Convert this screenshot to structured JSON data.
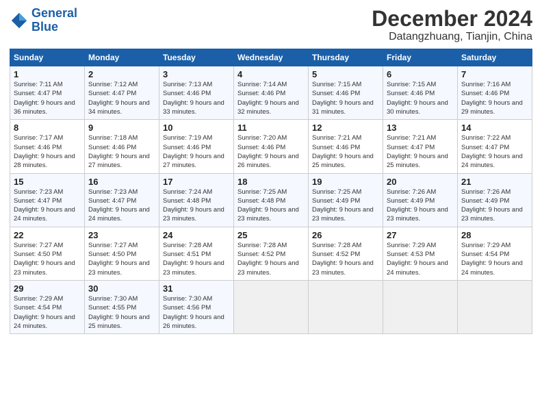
{
  "header": {
    "logo_line1": "General",
    "logo_line2": "Blue",
    "month": "December 2024",
    "location": "Datangzhuang, Tianjin, China"
  },
  "weekdays": [
    "Sunday",
    "Monday",
    "Tuesday",
    "Wednesday",
    "Thursday",
    "Friday",
    "Saturday"
  ],
  "weeks": [
    [
      {
        "day": "1",
        "sunrise": "7:11 AM",
        "sunset": "4:47 PM",
        "daylight": "9 hours and 36 minutes."
      },
      {
        "day": "2",
        "sunrise": "7:12 AM",
        "sunset": "4:47 PM",
        "daylight": "9 hours and 34 minutes."
      },
      {
        "day": "3",
        "sunrise": "7:13 AM",
        "sunset": "4:46 PM",
        "daylight": "9 hours and 33 minutes."
      },
      {
        "day": "4",
        "sunrise": "7:14 AM",
        "sunset": "4:46 PM",
        "daylight": "9 hours and 32 minutes."
      },
      {
        "day": "5",
        "sunrise": "7:15 AM",
        "sunset": "4:46 PM",
        "daylight": "9 hours and 31 minutes."
      },
      {
        "day": "6",
        "sunrise": "7:15 AM",
        "sunset": "4:46 PM",
        "daylight": "9 hours and 30 minutes."
      },
      {
        "day": "7",
        "sunrise": "7:16 AM",
        "sunset": "4:46 PM",
        "daylight": "9 hours and 29 minutes."
      }
    ],
    [
      {
        "day": "8",
        "sunrise": "7:17 AM",
        "sunset": "4:46 PM",
        "daylight": "9 hours and 28 minutes."
      },
      {
        "day": "9",
        "sunrise": "7:18 AM",
        "sunset": "4:46 PM",
        "daylight": "9 hours and 27 minutes."
      },
      {
        "day": "10",
        "sunrise": "7:19 AM",
        "sunset": "4:46 PM",
        "daylight": "9 hours and 27 minutes."
      },
      {
        "day": "11",
        "sunrise": "7:20 AM",
        "sunset": "4:46 PM",
        "daylight": "9 hours and 26 minutes."
      },
      {
        "day": "12",
        "sunrise": "7:21 AM",
        "sunset": "4:46 PM",
        "daylight": "9 hours and 25 minutes."
      },
      {
        "day": "13",
        "sunrise": "7:21 AM",
        "sunset": "4:47 PM",
        "daylight": "9 hours and 25 minutes."
      },
      {
        "day": "14",
        "sunrise": "7:22 AM",
        "sunset": "4:47 PM",
        "daylight": "9 hours and 24 minutes."
      }
    ],
    [
      {
        "day": "15",
        "sunrise": "7:23 AM",
        "sunset": "4:47 PM",
        "daylight": "9 hours and 24 minutes."
      },
      {
        "day": "16",
        "sunrise": "7:23 AM",
        "sunset": "4:47 PM",
        "daylight": "9 hours and 24 minutes."
      },
      {
        "day": "17",
        "sunrise": "7:24 AM",
        "sunset": "4:48 PM",
        "daylight": "9 hours and 23 minutes."
      },
      {
        "day": "18",
        "sunrise": "7:25 AM",
        "sunset": "4:48 PM",
        "daylight": "9 hours and 23 minutes."
      },
      {
        "day": "19",
        "sunrise": "7:25 AM",
        "sunset": "4:49 PM",
        "daylight": "9 hours and 23 minutes."
      },
      {
        "day": "20",
        "sunrise": "7:26 AM",
        "sunset": "4:49 PM",
        "daylight": "9 hours and 23 minutes."
      },
      {
        "day": "21",
        "sunrise": "7:26 AM",
        "sunset": "4:49 PM",
        "daylight": "9 hours and 23 minutes."
      }
    ],
    [
      {
        "day": "22",
        "sunrise": "7:27 AM",
        "sunset": "4:50 PM",
        "daylight": "9 hours and 23 minutes."
      },
      {
        "day": "23",
        "sunrise": "7:27 AM",
        "sunset": "4:50 PM",
        "daylight": "9 hours and 23 minutes."
      },
      {
        "day": "24",
        "sunrise": "7:28 AM",
        "sunset": "4:51 PM",
        "daylight": "9 hours and 23 minutes."
      },
      {
        "day": "25",
        "sunrise": "7:28 AM",
        "sunset": "4:52 PM",
        "daylight": "9 hours and 23 minutes."
      },
      {
        "day": "26",
        "sunrise": "7:28 AM",
        "sunset": "4:52 PM",
        "daylight": "9 hours and 23 minutes."
      },
      {
        "day": "27",
        "sunrise": "7:29 AM",
        "sunset": "4:53 PM",
        "daylight": "9 hours and 24 minutes."
      },
      {
        "day": "28",
        "sunrise": "7:29 AM",
        "sunset": "4:54 PM",
        "daylight": "9 hours and 24 minutes."
      }
    ],
    [
      {
        "day": "29",
        "sunrise": "7:29 AM",
        "sunset": "4:54 PM",
        "daylight": "9 hours and 24 minutes."
      },
      {
        "day": "30",
        "sunrise": "7:30 AM",
        "sunset": "4:55 PM",
        "daylight": "9 hours and 25 minutes."
      },
      {
        "day": "31",
        "sunrise": "7:30 AM",
        "sunset": "4:56 PM",
        "daylight": "9 hours and 26 minutes."
      },
      null,
      null,
      null,
      null
    ]
  ]
}
